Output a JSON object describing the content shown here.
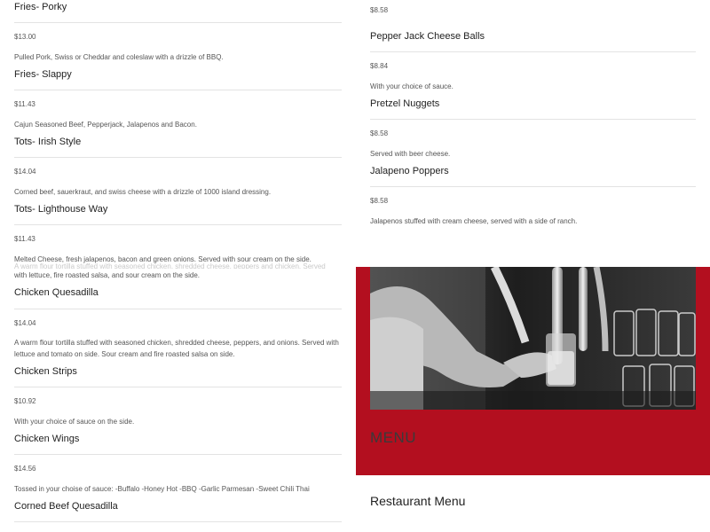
{
  "left_menu": {
    "items": [
      {
        "name": "Fries- Porky",
        "price": "$13.00",
        "desc": "Pulled Pork, Swiss or Cheddar and coleslaw with a drizzle of BBQ."
      },
      {
        "name": "Fries- Slappy",
        "price": "$11.43",
        "desc": "Cajun Seasoned Beef, Pepperjack, Jalapenos and Bacon."
      },
      {
        "name": "Tots- Irish Style",
        "price": "$14.04",
        "desc": "Corned beef, sauerkraut, and swiss cheese with a drizzle of 1000 island dressing."
      },
      {
        "name": "Tots- Lighthouse Way",
        "price": "$11.43",
        "desc": "Melted Cheese, fresh jalapenos, bacon and green onions. Served with sour cream on the side.",
        "overlap_text": "A warm flour tortilla stuffed with seasoned chicken, shredded cheese, peppers and chicken. Served",
        "overlap_text2": "with lettuce, fire roasted salsa, and sour cream on the side."
      },
      {
        "name": "Chicken Quesadilla",
        "price": "$14.04",
        "desc": "A warm flour tortilla stuffed with seasoned chicken, shredded cheese, peppers, and onions. Served with lettuce and tomato on side. Sour cream and fire roasted salsa on side."
      },
      {
        "name": "Chicken Strips",
        "price": "$10.92",
        "desc": "With your choice of sauce on the side."
      },
      {
        "name": "Chicken Wings",
        "price": "$14.56",
        "desc": "Tossed in your choise of sauce: -Buffalo -Honey Hot -BBQ -Garlic Parmesan -Sweet Chili Thai"
      },
      {
        "name": "Corned Beef Quesadilla"
      }
    ]
  },
  "right_menu": {
    "top_price": "$8.58",
    "items": [
      {
        "name": "Pepper Jack Cheese Balls",
        "price": "$8.84",
        "desc": "With your choice of sauce."
      },
      {
        "name": "Pretzel Nuggets",
        "price": "$8.58",
        "desc": "Served with beer cheese."
      },
      {
        "name": "Jalapeno Poppers",
        "price": "$8.58",
        "desc": "Jalapenos stuffed with cream cheese, served with a side of ranch."
      }
    ]
  },
  "section": {
    "menu_heading": "MENU",
    "restaurant_title": "Restaurant Menu"
  },
  "colors": {
    "accent_red": "#b30f1f"
  },
  "icons": {
    "photo": "bartender-pouring-beer-photo"
  }
}
